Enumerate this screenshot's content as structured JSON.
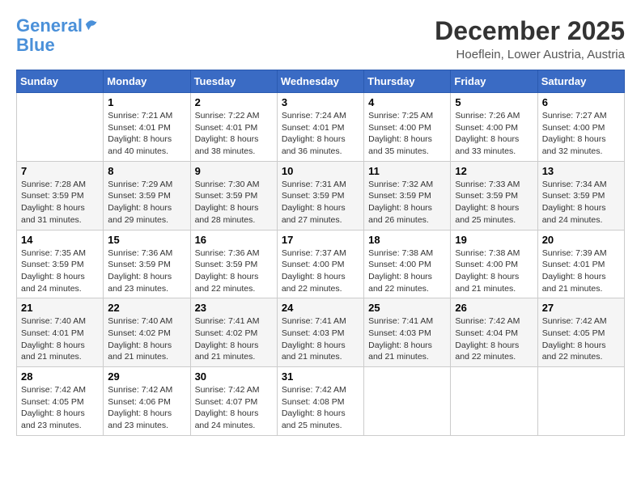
{
  "logo": {
    "line1": "General",
    "line2": "Blue"
  },
  "title": "December 2025",
  "subtitle": "Hoeflein, Lower Austria, Austria",
  "days_header": [
    "Sunday",
    "Monday",
    "Tuesday",
    "Wednesday",
    "Thursday",
    "Friday",
    "Saturday"
  ],
  "weeks": [
    [
      {
        "num": "",
        "info": ""
      },
      {
        "num": "1",
        "info": "Sunrise: 7:21 AM\nSunset: 4:01 PM\nDaylight: 8 hours\nand 40 minutes."
      },
      {
        "num": "2",
        "info": "Sunrise: 7:22 AM\nSunset: 4:01 PM\nDaylight: 8 hours\nand 38 minutes."
      },
      {
        "num": "3",
        "info": "Sunrise: 7:24 AM\nSunset: 4:01 PM\nDaylight: 8 hours\nand 36 minutes."
      },
      {
        "num": "4",
        "info": "Sunrise: 7:25 AM\nSunset: 4:00 PM\nDaylight: 8 hours\nand 35 minutes."
      },
      {
        "num": "5",
        "info": "Sunrise: 7:26 AM\nSunset: 4:00 PM\nDaylight: 8 hours\nand 33 minutes."
      },
      {
        "num": "6",
        "info": "Sunrise: 7:27 AM\nSunset: 4:00 PM\nDaylight: 8 hours\nand 32 minutes."
      }
    ],
    [
      {
        "num": "7",
        "info": "Sunrise: 7:28 AM\nSunset: 3:59 PM\nDaylight: 8 hours\nand 31 minutes."
      },
      {
        "num": "8",
        "info": "Sunrise: 7:29 AM\nSunset: 3:59 PM\nDaylight: 8 hours\nand 29 minutes."
      },
      {
        "num": "9",
        "info": "Sunrise: 7:30 AM\nSunset: 3:59 PM\nDaylight: 8 hours\nand 28 minutes."
      },
      {
        "num": "10",
        "info": "Sunrise: 7:31 AM\nSunset: 3:59 PM\nDaylight: 8 hours\nand 27 minutes."
      },
      {
        "num": "11",
        "info": "Sunrise: 7:32 AM\nSunset: 3:59 PM\nDaylight: 8 hours\nand 26 minutes."
      },
      {
        "num": "12",
        "info": "Sunrise: 7:33 AM\nSunset: 3:59 PM\nDaylight: 8 hours\nand 25 minutes."
      },
      {
        "num": "13",
        "info": "Sunrise: 7:34 AM\nSunset: 3:59 PM\nDaylight: 8 hours\nand 24 minutes."
      }
    ],
    [
      {
        "num": "14",
        "info": "Sunrise: 7:35 AM\nSunset: 3:59 PM\nDaylight: 8 hours\nand 24 minutes."
      },
      {
        "num": "15",
        "info": "Sunrise: 7:36 AM\nSunset: 3:59 PM\nDaylight: 8 hours\nand 23 minutes."
      },
      {
        "num": "16",
        "info": "Sunrise: 7:36 AM\nSunset: 3:59 PM\nDaylight: 8 hours\nand 22 minutes."
      },
      {
        "num": "17",
        "info": "Sunrise: 7:37 AM\nSunset: 4:00 PM\nDaylight: 8 hours\nand 22 minutes."
      },
      {
        "num": "18",
        "info": "Sunrise: 7:38 AM\nSunset: 4:00 PM\nDaylight: 8 hours\nand 22 minutes."
      },
      {
        "num": "19",
        "info": "Sunrise: 7:38 AM\nSunset: 4:00 PM\nDaylight: 8 hours\nand 21 minutes."
      },
      {
        "num": "20",
        "info": "Sunrise: 7:39 AM\nSunset: 4:01 PM\nDaylight: 8 hours\nand 21 minutes."
      }
    ],
    [
      {
        "num": "21",
        "info": "Sunrise: 7:40 AM\nSunset: 4:01 PM\nDaylight: 8 hours\nand 21 minutes."
      },
      {
        "num": "22",
        "info": "Sunrise: 7:40 AM\nSunset: 4:02 PM\nDaylight: 8 hours\nand 21 minutes."
      },
      {
        "num": "23",
        "info": "Sunrise: 7:41 AM\nSunset: 4:02 PM\nDaylight: 8 hours\nand 21 minutes."
      },
      {
        "num": "24",
        "info": "Sunrise: 7:41 AM\nSunset: 4:03 PM\nDaylight: 8 hours\nand 21 minutes."
      },
      {
        "num": "25",
        "info": "Sunrise: 7:41 AM\nSunset: 4:03 PM\nDaylight: 8 hours\nand 21 minutes."
      },
      {
        "num": "26",
        "info": "Sunrise: 7:42 AM\nSunset: 4:04 PM\nDaylight: 8 hours\nand 22 minutes."
      },
      {
        "num": "27",
        "info": "Sunrise: 7:42 AM\nSunset: 4:05 PM\nDaylight: 8 hours\nand 22 minutes."
      }
    ],
    [
      {
        "num": "28",
        "info": "Sunrise: 7:42 AM\nSunset: 4:05 PM\nDaylight: 8 hours\nand 23 minutes."
      },
      {
        "num": "29",
        "info": "Sunrise: 7:42 AM\nSunset: 4:06 PM\nDaylight: 8 hours\nand 23 minutes."
      },
      {
        "num": "30",
        "info": "Sunrise: 7:42 AM\nSunset: 4:07 PM\nDaylight: 8 hours\nand 24 minutes."
      },
      {
        "num": "31",
        "info": "Sunrise: 7:42 AM\nSunset: 4:08 PM\nDaylight: 8 hours\nand 25 minutes."
      },
      {
        "num": "",
        "info": ""
      },
      {
        "num": "",
        "info": ""
      },
      {
        "num": "",
        "info": ""
      }
    ]
  ]
}
